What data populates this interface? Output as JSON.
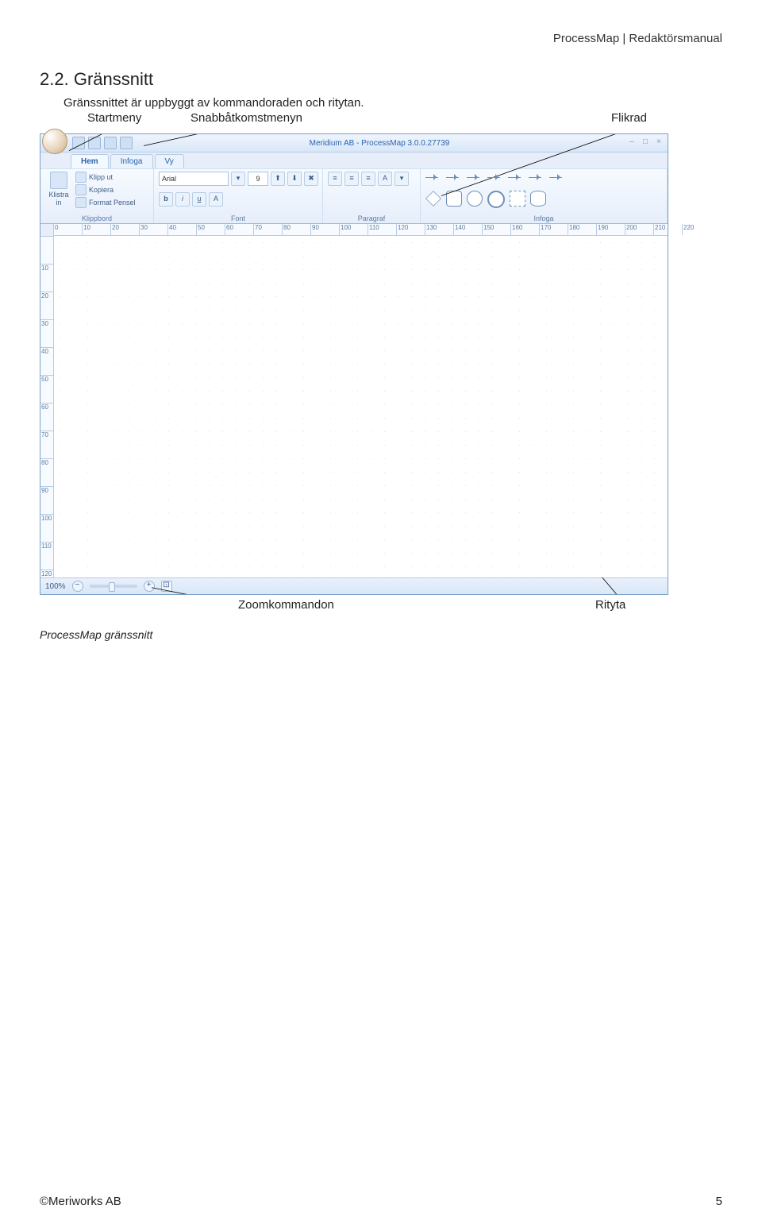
{
  "header": {
    "right": "ProcessMap | Redaktörsmanual"
  },
  "section": {
    "num": "2.2.",
    "title": "Gränssnitt"
  },
  "intro": "Gränssnittet är uppbyggt av kommandoraden och ritytan.",
  "annot": {
    "startmeny": "Startmeny",
    "snabb": "Snabbåtkomstmenyn",
    "flikrad": "Flikrad",
    "zoom": "Zoomkommandon",
    "rityta": "Rityta"
  },
  "shot": {
    "title": "Meridium AB - ProcessMap 3.0.0.27739",
    "tabs": [
      "Hem",
      "Infoga",
      "Vy"
    ],
    "groups": {
      "klippbord": {
        "label": "Klippbord",
        "paste": "Klistra\nin",
        "cut": "Klipp ut",
        "copy": "Kopiera",
        "fmt": "Format Pensel"
      },
      "font": {
        "label": "Font",
        "name": "Arial",
        "size": "9",
        "bold": "b",
        "italic": "i",
        "under": "u"
      },
      "paragraf": {
        "label": "Paragraf"
      },
      "infoga": {
        "label": "Infoga"
      }
    },
    "rulerH": [
      "0",
      "10",
      "20",
      "30",
      "40",
      "50",
      "60",
      "70",
      "80",
      "90",
      "100",
      "110",
      "120",
      "130",
      "140",
      "150",
      "160",
      "170",
      "180",
      "190",
      "200",
      "210",
      "220"
    ],
    "rulerV": [
      "",
      "10",
      "20",
      "30",
      "40",
      "50",
      "60",
      "70",
      "80",
      "90",
      "100",
      "110",
      "120"
    ],
    "zoom": "100%"
  },
  "caption": "ProcessMap gränssnitt",
  "footer": {
    "left": "©Meriworks AB",
    "right": "5"
  }
}
